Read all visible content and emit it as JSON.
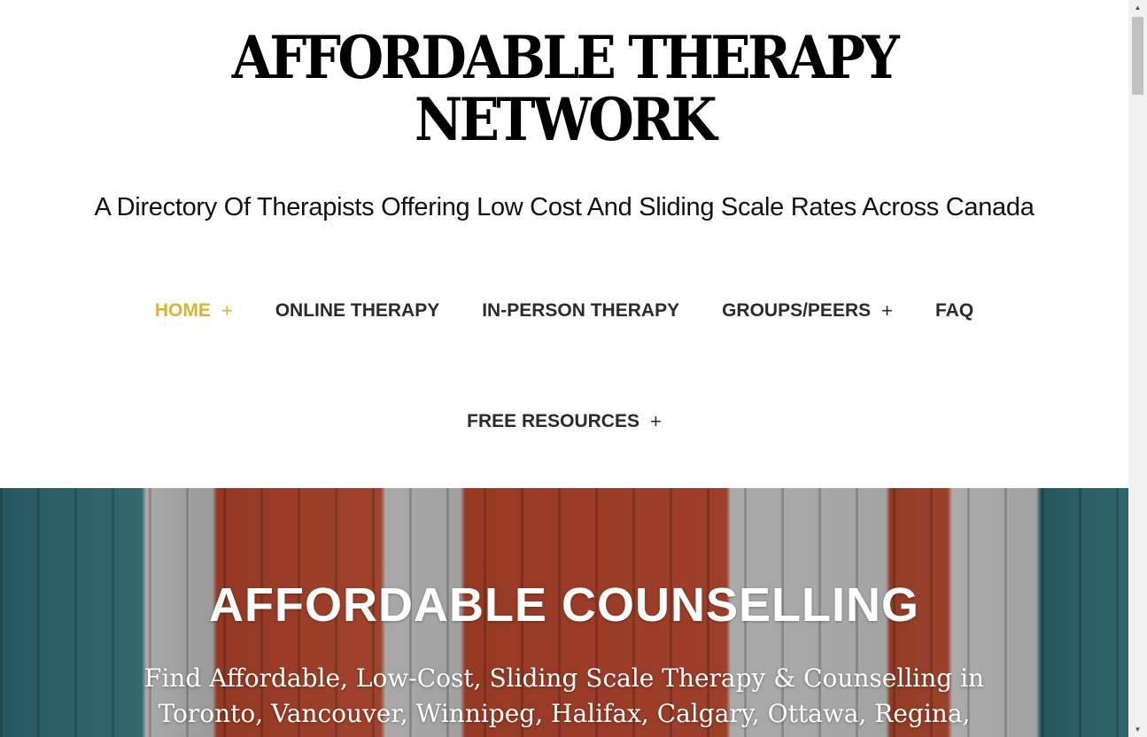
{
  "header": {
    "title_line1": "AFFORDABLE THERAPY",
    "title_line2": "NETWORK",
    "tagline": "A Directory Of Therapists Offering Low Cost And Sliding Scale Rates Across Canada"
  },
  "nav": {
    "row1": [
      {
        "label": "HOME",
        "has_submenu": true,
        "active": true
      },
      {
        "label": "ONLINE THERAPY",
        "has_submenu": false,
        "active": false
      },
      {
        "label": "IN-PERSON THERAPY",
        "has_submenu": false,
        "active": false
      },
      {
        "label": "GROUPS/PEERS",
        "has_submenu": true,
        "active": false
      },
      {
        "label": "FAQ",
        "has_submenu": false,
        "active": false
      }
    ],
    "row2": [
      {
        "label": "FREE RESOURCES",
        "has_submenu": true,
        "active": false
      }
    ],
    "submenu_symbol": "+"
  },
  "hero": {
    "title": "AFFORDABLE COUNSELLING",
    "subtitle_line1": "Find Affordable, Low-Cost, Sliding Scale Therapy & Counselling in",
    "subtitle_line2": "Toronto, Vancouver, Winnipeg, Halifax, Calgary, Ottawa, Regina,"
  },
  "colors": {
    "active_nav": "#d9b332",
    "nav_text": "#2b2b2b",
    "title_text": "#000000"
  },
  "icons": {
    "submenu": "plus-icon",
    "scroll_up": "scroll-up-arrow-icon",
    "scroll_down": "scroll-down-arrow-icon"
  }
}
